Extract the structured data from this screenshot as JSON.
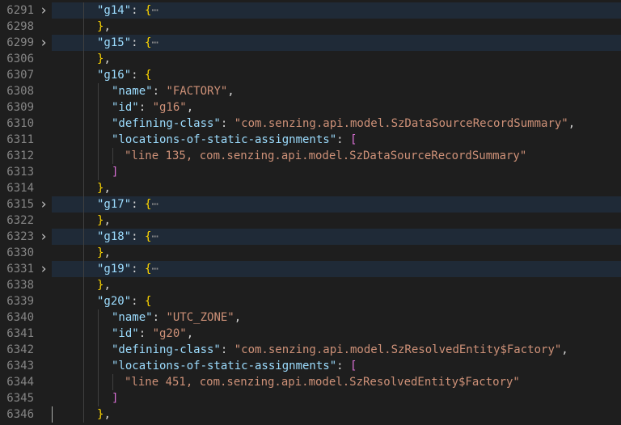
{
  "lines": [
    {
      "ln": "6291",
      "folded": true,
      "indent": 1,
      "tokens": [
        [
          "key",
          "\"g14\""
        ],
        [
          "p",
          ": "
        ],
        [
          "b1",
          "{"
        ],
        [
          "ell",
          "⋯"
        ]
      ]
    },
    {
      "ln": "6298",
      "indent": 1,
      "tokens": [
        [
          "b1",
          "}"
        ],
        [
          "p",
          ","
        ]
      ]
    },
    {
      "ln": "6299",
      "folded": true,
      "indent": 1,
      "tokens": [
        [
          "key",
          "\"g15\""
        ],
        [
          "p",
          ": "
        ],
        [
          "b1",
          "{"
        ],
        [
          "ell",
          "⋯"
        ]
      ]
    },
    {
      "ln": "6306",
      "indent": 1,
      "tokens": [
        [
          "b1",
          "}"
        ],
        [
          "p",
          ","
        ]
      ]
    },
    {
      "ln": "6307",
      "indent": 1,
      "tokens": [
        [
          "key",
          "\"g16\""
        ],
        [
          "p",
          ": "
        ],
        [
          "b1",
          "{"
        ]
      ]
    },
    {
      "ln": "6308",
      "indent": 2,
      "tokens": [
        [
          "key",
          "\"name\""
        ],
        [
          "p",
          ": "
        ],
        [
          "str",
          "\"FACTORY\""
        ],
        [
          "p",
          ","
        ]
      ]
    },
    {
      "ln": "6309",
      "indent": 2,
      "tokens": [
        [
          "key",
          "\"id\""
        ],
        [
          "p",
          ": "
        ],
        [
          "str",
          "\"g16\""
        ],
        [
          "p",
          ","
        ]
      ]
    },
    {
      "ln": "6310",
      "indent": 2,
      "tokens": [
        [
          "key",
          "\"defining-class\""
        ],
        [
          "p",
          ": "
        ],
        [
          "str",
          "\"com.senzing.api.model.SzDataSourceRecordSummary\""
        ],
        [
          "p",
          ","
        ]
      ]
    },
    {
      "ln": "6311",
      "indent": 2,
      "tokens": [
        [
          "key",
          "\"locations-of-static-assignments\""
        ],
        [
          "p",
          ": "
        ],
        [
          "b2",
          "["
        ]
      ]
    },
    {
      "ln": "6312",
      "indent": 3,
      "tokens": [
        [
          "str",
          "\"line 135, com.senzing.api.model.SzDataSourceRecordSummary\""
        ]
      ]
    },
    {
      "ln": "6313",
      "indent": 2,
      "tokens": [
        [
          "b2",
          "]"
        ]
      ]
    },
    {
      "ln": "6314",
      "indent": 1,
      "tokens": [
        [
          "b1",
          "}"
        ],
        [
          "p",
          ","
        ]
      ]
    },
    {
      "ln": "6315",
      "folded": true,
      "indent": 1,
      "tokens": [
        [
          "key",
          "\"g17\""
        ],
        [
          "p",
          ": "
        ],
        [
          "b1",
          "{"
        ],
        [
          "ell",
          "⋯"
        ]
      ]
    },
    {
      "ln": "6322",
      "indent": 1,
      "tokens": [
        [
          "b1",
          "}"
        ],
        [
          "p",
          ","
        ]
      ]
    },
    {
      "ln": "6323",
      "folded": true,
      "indent": 1,
      "tokens": [
        [
          "key",
          "\"g18\""
        ],
        [
          "p",
          ": "
        ],
        [
          "b1",
          "{"
        ],
        [
          "ell",
          "⋯"
        ]
      ]
    },
    {
      "ln": "6330",
      "indent": 1,
      "tokens": [
        [
          "b1",
          "}"
        ],
        [
          "p",
          ","
        ]
      ]
    },
    {
      "ln": "6331",
      "folded": true,
      "indent": 1,
      "tokens": [
        [
          "key",
          "\"g19\""
        ],
        [
          "p",
          ": "
        ],
        [
          "b1",
          "{"
        ],
        [
          "ell",
          "⋯"
        ]
      ]
    },
    {
      "ln": "6338",
      "indent": 1,
      "tokens": [
        [
          "b1",
          "}"
        ],
        [
          "p",
          ","
        ]
      ]
    },
    {
      "ln": "6339",
      "indent": 1,
      "tokens": [
        [
          "key",
          "\"g20\""
        ],
        [
          "p",
          ": "
        ],
        [
          "b1",
          "{"
        ]
      ]
    },
    {
      "ln": "6340",
      "indent": 2,
      "tokens": [
        [
          "key",
          "\"name\""
        ],
        [
          "p",
          ": "
        ],
        [
          "str",
          "\"UTC_ZONE\""
        ],
        [
          "p",
          ","
        ]
      ]
    },
    {
      "ln": "6341",
      "indent": 2,
      "tokens": [
        [
          "key",
          "\"id\""
        ],
        [
          "p",
          ": "
        ],
        [
          "str",
          "\"g20\""
        ],
        [
          "p",
          ","
        ]
      ]
    },
    {
      "ln": "6342",
      "indent": 2,
      "tokens": [
        [
          "key",
          "\"defining-class\""
        ],
        [
          "p",
          ": "
        ],
        [
          "str",
          "\"com.senzing.api.model.SzResolvedEntity$Factory\""
        ],
        [
          "p",
          ","
        ]
      ]
    },
    {
      "ln": "6343",
      "indent": 2,
      "tokens": [
        [
          "key",
          "\"locations-of-static-assignments\""
        ],
        [
          "p",
          ": "
        ],
        [
          "b2",
          "["
        ]
      ]
    },
    {
      "ln": "6344",
      "indent": 3,
      "tokens": [
        [
          "str",
          "\"line 451, com.senzing.api.model.SzResolvedEntity$Factory\""
        ]
      ]
    },
    {
      "ln": "6345",
      "indent": 2,
      "tokens": [
        [
          "b2",
          "]"
        ]
      ]
    },
    {
      "ln": "6346",
      "indent": 1,
      "tokens": [
        [
          "b1",
          "}"
        ],
        [
          "p",
          ","
        ]
      ]
    }
  ],
  "fold_icon": "chevron-right-icon",
  "colors": {
    "background": "#1e1e1e",
    "line_number": "#858585",
    "key": "#9cdcfe",
    "string": "#ce9178",
    "bracket_level1": "#ffd700",
    "bracket_level2": "#da70d6",
    "folded_highlight": "#1f2a37"
  }
}
